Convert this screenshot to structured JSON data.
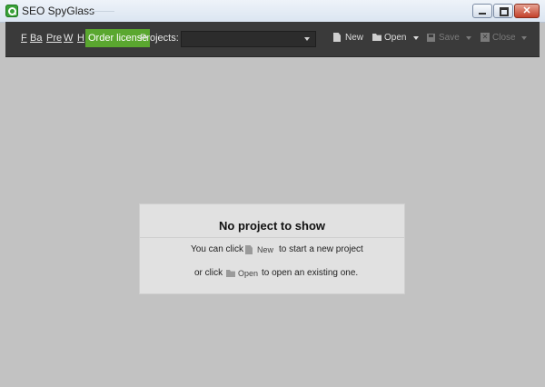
{
  "window": {
    "title": "SEO SpyGlass"
  },
  "menu": {
    "items": [
      "F",
      "Ba",
      "Pre",
      "W",
      "H"
    ]
  },
  "toolbar": {
    "order_label": "Order license",
    "projects_label": "Projects:",
    "projects_value": "",
    "new_label": "New",
    "open_label": "Open",
    "save_label": "Save",
    "close_label": "Close"
  },
  "empty_state": {
    "title": "No project to show",
    "line1_before": "You can click",
    "line1_after": "to start a new project",
    "line2_before": "or click",
    "line2_after": "to open an existing one.",
    "new_label": "New",
    "open_label": "Open"
  },
  "colors": {
    "accent": "#5aa72f",
    "toolbar": "#3a3a3a",
    "workspace": "#c2c2c2"
  }
}
